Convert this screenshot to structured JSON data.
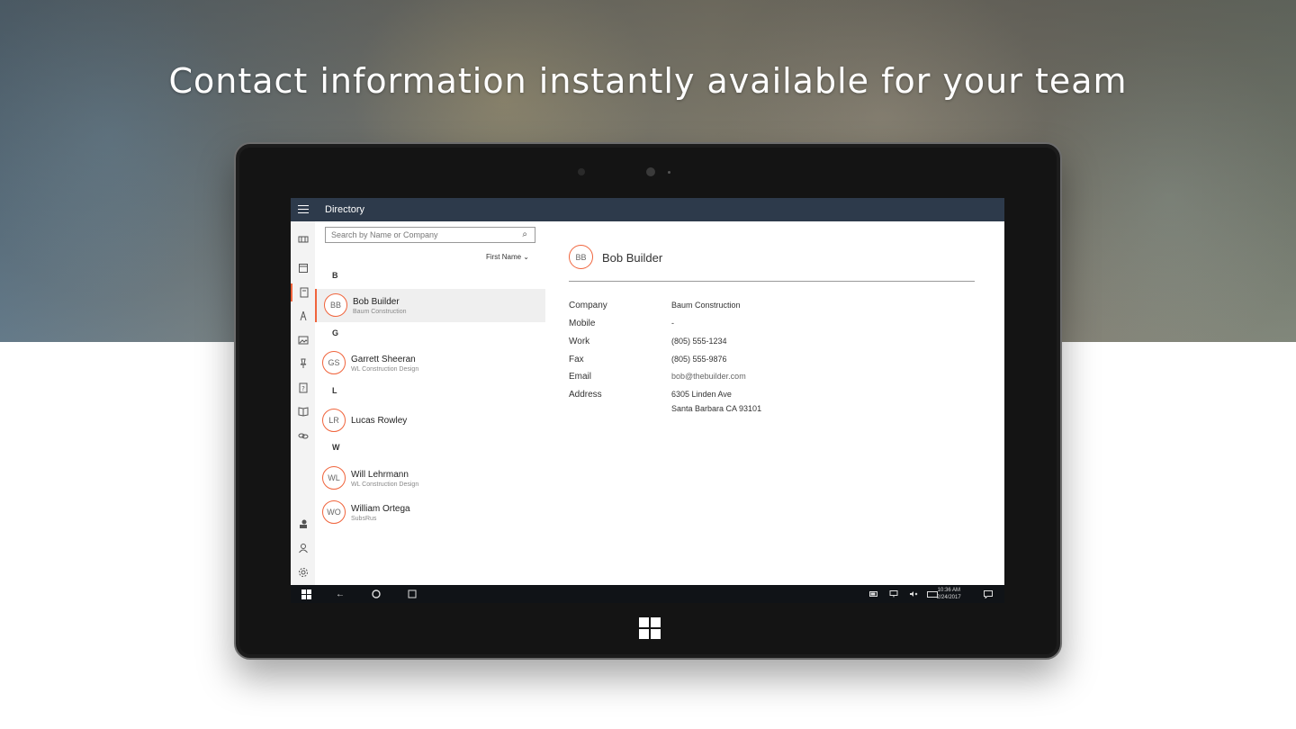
{
  "headline": "Contact information instantly available for your team",
  "app": {
    "title": "Directory"
  },
  "search": {
    "placeholder": "Search by Name or Company"
  },
  "sort": {
    "label": "First Name ⌄"
  },
  "groups": [
    {
      "letter": "B"
    },
    {
      "letter": "G"
    },
    {
      "letter": "L"
    },
    {
      "letter": "W"
    }
  ],
  "contacts": [
    {
      "initials": "BB",
      "name": "Bob Builder",
      "company": "Baum Construction"
    },
    {
      "initials": "GS",
      "name": "Garrett Sheeran",
      "company": "WL Construction Design"
    },
    {
      "initials": "LR",
      "name": "Lucas Rowley",
      "company": ""
    },
    {
      "initials": "WL",
      "name": "Will Lehrmann",
      "company": "WL Construction Design"
    },
    {
      "initials": "WO",
      "name": "William Ortega",
      "company": "SubsRus"
    }
  ],
  "detail": {
    "initials": "BB",
    "name": "Bob Builder",
    "fields": [
      {
        "label": "Company",
        "value": "Baum Construction"
      },
      {
        "label": "Mobile",
        "value": "-"
      },
      {
        "label": "Work",
        "value": "(805) 555-1234"
      },
      {
        "label": "Fax",
        "value": "(805) 555-9876"
      },
      {
        "label": "Email",
        "value": "bob@thebuilder.com"
      },
      {
        "label": "Address",
        "value": "6305 Linden Ave",
        "value2": "Santa Barbara CA 93101"
      }
    ]
  },
  "taskbar": {
    "time": "10:36 AM",
    "date": "2/24/2017"
  },
  "colors": {
    "accent": "#f0643c",
    "titlebar": "#2d3a4b"
  },
  "icons": [
    "hamburger-icon",
    "projects-icon",
    "calendar-icon",
    "directory-icon",
    "tools-icon",
    "photos-icon",
    "pin-icon",
    "rfi-icon",
    "book-icon",
    "link-icon",
    "user-switch-icon",
    "person-icon",
    "settings-icon",
    "search-icon"
  ]
}
